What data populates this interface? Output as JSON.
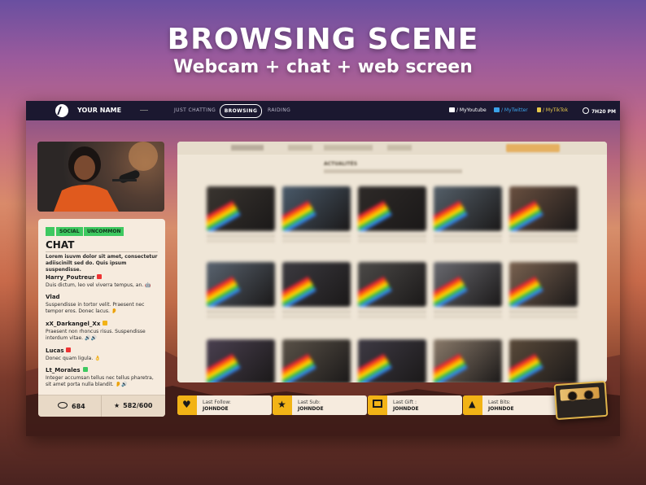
{
  "hero": {
    "title": "BROWSING SCENE",
    "subtitle": "Webcam + chat + web screen"
  },
  "topbar": {
    "name": "YOUR NAME",
    "nav": [
      "JUST CHATTING",
      "BROWSING",
      "RAIDING"
    ],
    "active": "BROWSING",
    "socials": [
      {
        "label": "/ MyYoutube",
        "icon": "youtube-icon",
        "color": "#ffffff"
      },
      {
        "label": "/ MyTwitter",
        "icon": "twitter-icon",
        "color": "#3aa2e8"
      },
      {
        "label": "/ MyTikTok",
        "icon": "tiktok-icon",
        "color": "#e6c84a"
      }
    ],
    "time": "7H20 PM"
  },
  "chat": {
    "tags": [
      "SOCIAL",
      "UNCOMMON"
    ],
    "title": "CHAT",
    "intro": "Lorem isuvm dolor sit amet, consectetur adiiscinilt sed do. Quis ipsum suspendisse.",
    "messages": [
      {
        "user": "Harry_Poutreur",
        "text": "Duis dictum, leo vel viverra tempus, an. 🤖"
      },
      {
        "user": "Vlad",
        "text": "Suspendisse in tortor velit. Praesent nec tempor eros. Donec lacus. 👂"
      },
      {
        "user": "xX_Darkangel_Xx",
        "text": "Praesent non rhoncus risus. Suspendisse interdum vitae. 🔊🔊"
      },
      {
        "user": "Lucas",
        "text": "Donec quam ligula. 👌"
      },
      {
        "user": "Lt_Morales",
        "text": "Integer accumsan tellus nec tellus pharetra, sit amet porta nulla blandit. 👂🔊"
      }
    ],
    "viewers": "684",
    "followers_goal": "582/600"
  },
  "screen": {
    "section": "ACTUALITÉS"
  },
  "alerts": [
    {
      "label": "Last Follow:",
      "value": "JOHNDOE",
      "icon": "heart-icon"
    },
    {
      "label": "Last Sub:",
      "value": "JOHNDOE",
      "icon": "star-icon"
    },
    {
      "label": "Last Gift :",
      "value": "JOHNDOE",
      "icon": "gift-icon"
    },
    {
      "label": "Last Bits:",
      "value": "JOHNDOE",
      "icon": "bits-icon"
    }
  ],
  "colors": {
    "accent": "#f2b316",
    "tag_green": "#3ec860",
    "panel": "#f6ebde",
    "topbar": "#1b1830"
  }
}
